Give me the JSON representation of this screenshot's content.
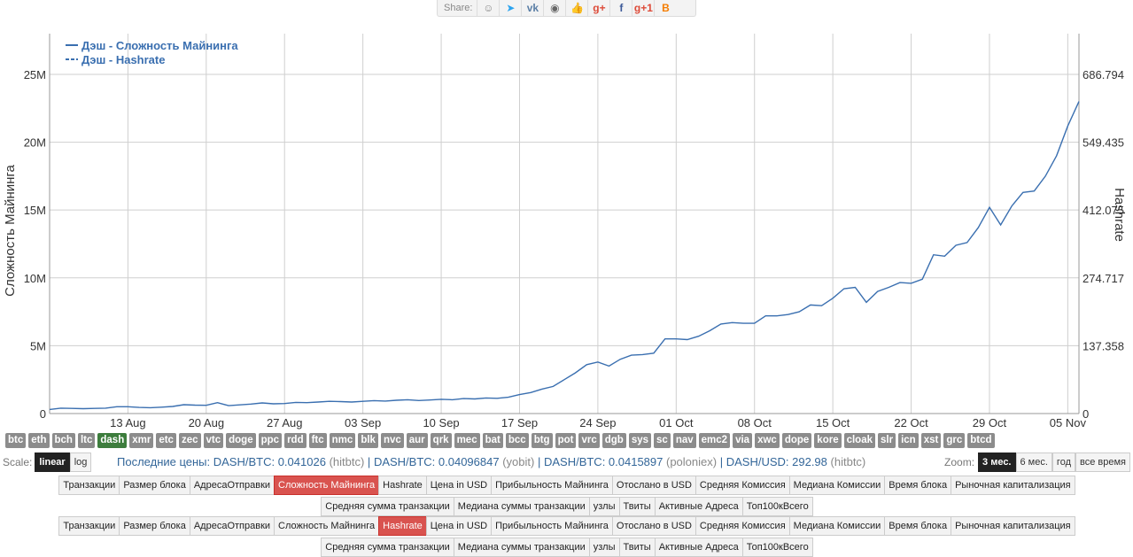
{
  "share": {
    "label": "Share:",
    "buttons": [
      {
        "name": "reddit-icon",
        "glyph": "☺",
        "color": "#888888"
      },
      {
        "name": "twitter-icon",
        "glyph": "➤",
        "color": "#2aa3ef"
      },
      {
        "name": "vk-icon",
        "glyph": "vk",
        "color": "#5b7fa6"
      },
      {
        "name": "weibo-icon",
        "glyph": "◉",
        "color": "#666666"
      },
      {
        "name": "like-icon",
        "glyph": "👍",
        "color": "#4a76a8"
      },
      {
        "name": "google-plus-icon",
        "glyph": "g+",
        "color": "#dd4b39"
      },
      {
        "name": "facebook-icon",
        "glyph": "f",
        "color": "#3b5998"
      },
      {
        "name": "google-plus-one-icon",
        "glyph": "g+1",
        "color": "#dd4b39"
      },
      {
        "name": "blogger-icon",
        "glyph": "B",
        "color": "#f57d00"
      }
    ]
  },
  "chart_data": {
    "type": "line",
    "title": "",
    "xlabel": "",
    "ylabel": "Сложность Майнинга",
    "y2label": "Hashrate",
    "x_ticks": [
      "13 Aug",
      "20 Aug",
      "27 Aug",
      "03 Sep",
      "10 Sep",
      "17 Sep",
      "24 Sep",
      "01 Oct",
      "08 Oct",
      "15 Oct",
      "22 Oct",
      "29 Oct",
      "05 Nov"
    ],
    "y_ticks": [
      "0",
      "5M",
      "10M",
      "15M",
      "20M",
      "25M"
    ],
    "y_tick_values": [
      0,
      5000000,
      10000000,
      15000000,
      20000000,
      25000000
    ],
    "y2_ticks": [
      "0",
      "137.358",
      "274.717",
      "412.075",
      "549.435",
      "686.794"
    ],
    "ylim": [
      0,
      28000000
    ],
    "x_start_date": "2017-08-06",
    "x_end_date": "2017-11-06",
    "grid": true,
    "legend_position": "top-left",
    "series": [
      {
        "name": "Дэш - Сложность Майнинга",
        "axis": "left",
        "style": "solid",
        "color": "#3a6fb0",
        "x": [
          "2017-08-06",
          "2017-08-07",
          "2017-08-08",
          "2017-08-09",
          "2017-08-10",
          "2017-08-11",
          "2017-08-12",
          "2017-08-13",
          "2017-08-14",
          "2017-08-15",
          "2017-08-16",
          "2017-08-17",
          "2017-08-18",
          "2017-08-19",
          "2017-08-20",
          "2017-08-21",
          "2017-08-22",
          "2017-08-23",
          "2017-08-24",
          "2017-08-25",
          "2017-08-26",
          "2017-08-27",
          "2017-08-28",
          "2017-08-29",
          "2017-08-30",
          "2017-08-31",
          "2017-09-01",
          "2017-09-02",
          "2017-09-03",
          "2017-09-04",
          "2017-09-05",
          "2017-09-06",
          "2017-09-07",
          "2017-09-08",
          "2017-09-09",
          "2017-09-10",
          "2017-09-11",
          "2017-09-12",
          "2017-09-13",
          "2017-09-14",
          "2017-09-15",
          "2017-09-16",
          "2017-09-17",
          "2017-09-18",
          "2017-09-19",
          "2017-09-20",
          "2017-09-21",
          "2017-09-22",
          "2017-09-23",
          "2017-09-24",
          "2017-09-25",
          "2017-09-26",
          "2017-09-27",
          "2017-09-28",
          "2017-09-29",
          "2017-09-30",
          "2017-10-01",
          "2017-10-02",
          "2017-10-03",
          "2017-10-04",
          "2017-10-05",
          "2017-10-06",
          "2017-10-07",
          "2017-10-08",
          "2017-10-09",
          "2017-10-10",
          "2017-10-11",
          "2017-10-12",
          "2017-10-13",
          "2017-10-14",
          "2017-10-15",
          "2017-10-16",
          "2017-10-17",
          "2017-10-18",
          "2017-10-19",
          "2017-10-20",
          "2017-10-21",
          "2017-10-22",
          "2017-10-23",
          "2017-10-24",
          "2017-10-25",
          "2017-10-26",
          "2017-10-27",
          "2017-10-28",
          "2017-10-29",
          "2017-10-30",
          "2017-10-31",
          "2017-11-01",
          "2017-11-02",
          "2017-11-03",
          "2017-11-04",
          "2017-11-05",
          "2017-11-06"
        ],
        "y": [
          300000,
          400000,
          380000,
          360000,
          380000,
          400000,
          500000,
          500000,
          450000,
          430000,
          470000,
          520000,
          650000,
          620000,
          610000,
          800000,
          580000,
          640000,
          700000,
          780000,
          720000,
          740000,
          820000,
          800000,
          850000,
          900000,
          880000,
          850000,
          900000,
          950000,
          920000,
          980000,
          1020000,
          960000,
          1000000,
          1050000,
          1020000,
          1100000,
          1080000,
          1150000,
          1120000,
          1200000,
          1400000,
          1550000,
          1800000,
          2000000,
          2500000,
          3000000,
          3600000,
          3800000,
          3500000,
          4000000,
          4300000,
          4350000,
          4450000,
          5500000,
          5500000,
          5450000,
          5700000,
          6100000,
          6600000,
          6700000,
          6650000,
          6650000,
          7200000,
          7200000,
          7300000,
          7500000,
          8000000,
          7950000,
          8500000,
          9200000,
          9300000,
          8200000,
          9000000,
          9300000,
          9650000,
          9600000,
          9900000,
          11700000,
          11600000,
          12400000,
          12600000,
          13700000,
          15200000,
          13900000,
          15300000,
          16300000,
          16400000,
          17500000,
          19000000,
          21200000,
          23000000
        ]
      },
      {
        "name": "Дэш - Hashrate",
        "axis": "right",
        "style": "dashed",
        "color": "#3a6fb0",
        "x": [],
        "y": []
      }
    ]
  },
  "coins": [
    "btc",
    "eth",
    "bch",
    "ltc",
    "dash",
    "xmr",
    "etc",
    "zec",
    "vtc",
    "doge",
    "ppc",
    "rdd",
    "ftc",
    "nmc",
    "blk",
    "nvc",
    "aur",
    "qrk",
    "mec",
    "bat",
    "bcc",
    "btg",
    "pot",
    "vrc",
    "dgb",
    "sys",
    "sc",
    "nav",
    "emc2",
    "via",
    "xwc",
    "dope",
    "kore",
    "cloak",
    "slr",
    "icn",
    "xst",
    "grc",
    "btcd"
  ],
  "active_coin": "dash",
  "scale": {
    "label": "Scale:",
    "linear": "linear",
    "log": "log"
  },
  "prices": {
    "p1_label": "Последние цены: DASH/BTC: 0.041026",
    "p1_src": "(hitbtc)",
    "sep": "|",
    "p2_label": "DASH/BTC: 0.04096847",
    "p2_src": "(yobit)",
    "p3_label": "DASH/BTC: 0.0415897",
    "p3_src": "(poloniex)",
    "p4_label": "DASH/USD: 292.98",
    "p4_src": "(hitbtc)"
  },
  "zoom": {
    "label": "Zoom:",
    "options": [
      "3 мес.",
      "6 мес.",
      "год",
      "все время"
    ],
    "active": 0
  },
  "tabs1": {
    "items": [
      "Транзакции",
      "Размер блока",
      "АдресаОтправки",
      "Сложность Майнинга",
      "Hashrate",
      "Цена in USD",
      "Прибыльность Майнинга",
      "Отослано в USD",
      "Средняя Комиссия",
      "Медиана Комиссии",
      "Время блока",
      "Рыночная капитализация",
      "Средняя сумма транзакции",
      "Медиана суммы транзакции",
      "узлы",
      "Твиты",
      "Активные Адреса",
      "Топ100кВсего"
    ],
    "active": 3
  },
  "tabs2": {
    "items": [
      "Транзакции",
      "Размер блока",
      "АдресаОтправки",
      "Сложность Майнинга",
      "Hashrate",
      "Цена in USD",
      "Прибыльность Майнинга",
      "Отослано в USD",
      "Средняя Комиссия",
      "Медиана Комиссии",
      "Время блока",
      "Рыночная капитализация",
      "Средняя сумма транзакции",
      "Медиана суммы транзакции",
      "узлы",
      "Твиты",
      "Активные Адреса",
      "Топ100кВсего"
    ],
    "active": 4
  }
}
